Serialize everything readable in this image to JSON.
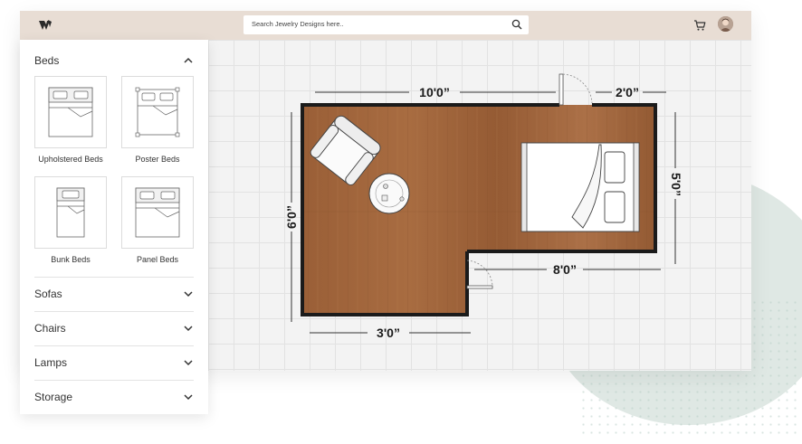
{
  "header": {
    "logo_icon": "brand-logo-icon",
    "search_placeholder": "Search Jewelry Designs here..",
    "search_icon": "search-icon",
    "cart_icon": "cart-icon",
    "avatar": "user-avatar"
  },
  "sidebar": {
    "beds": {
      "label": "Beds",
      "expanded": true,
      "items": [
        {
          "label": "Upholstered Beds"
        },
        {
          "label": "Poster Beds"
        },
        {
          "label": "Bunk Beds"
        },
        {
          "label": "Panel Beds"
        }
      ]
    },
    "sofas": {
      "label": "Sofas"
    },
    "chairs": {
      "label": "Chairs"
    },
    "lamps": {
      "label": "Lamps"
    },
    "storage": {
      "label": "Storage"
    }
  },
  "floorplan": {
    "dim_top": "10'0”",
    "dim_top_right": "2'0”",
    "dim_right": "5'0”",
    "dim_left": "6'0”",
    "dim_inner": "8'0”",
    "dim_bottom": "3'0”"
  },
  "colors": {
    "topbar": "#e8ddd4",
    "floor": "#a0653c",
    "wall": "#1b1b1b",
    "accent_circle": "#dfe8e4"
  }
}
